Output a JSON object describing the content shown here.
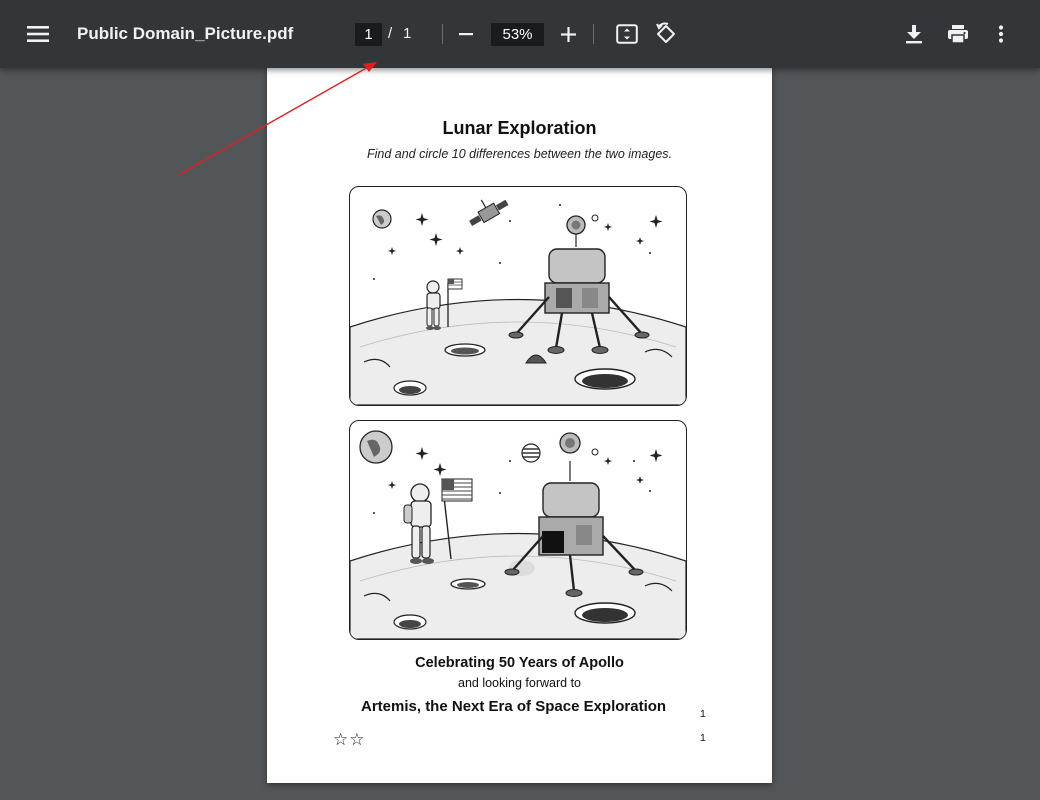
{
  "toolbar": {
    "menu_icon": "menu-icon",
    "file_title": "Public Domain_Picture.pdf",
    "page_current": "1",
    "page_separator": "/",
    "page_total": "1",
    "zoom_out_icon": "minus-icon",
    "zoom_level": "53%",
    "zoom_in_icon": "plus-icon",
    "fit_page_icon": "fit-to-page-icon",
    "rotate_icon": "rotate-icon",
    "download_icon": "download-icon",
    "print_icon": "print-icon",
    "more_icon": "more-vertical-icon"
  },
  "document": {
    "title": "Lunar Exploration",
    "subtitle": "Find and circle 10 differences between the two images.",
    "caption_line1": "Celebrating 50 Years of Apollo",
    "caption_line2": "and looking forward to",
    "caption_line3": "Artemis, the Next Era of Space Exploration",
    "footnote_1": "1",
    "footnote_2": "1",
    "stars": "☆☆"
  },
  "annotation": {
    "type": "arrow",
    "color": "#e02020"
  },
  "colors": {
    "toolbar_bg": "#323639",
    "viewer_bg": "#525659",
    "page_bg": "#ffffff"
  }
}
